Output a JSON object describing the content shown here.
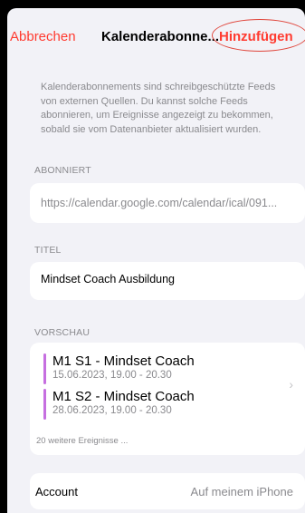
{
  "nav": {
    "cancel_label": "Abbrechen",
    "title": "Kalenderabonne...",
    "add_label": "Hinzufügen"
  },
  "intro_text": "Kalenderabonnements sind schreibgeschützte Feeds von externen Quellen. Du kannst solche Feeds abonnieren, um Ereignisse angezeigt zu bekommen, sobald sie vom Datenanbieter aktualisiert wurden.",
  "subscribed": {
    "header": "ABONNIERT",
    "url": "https://calendar.google.com/calendar/ical/091..."
  },
  "title_section": {
    "header": "TITEL",
    "value": "Mindset Coach Ausbildung"
  },
  "preview": {
    "header": "VORSCHAU",
    "events": [
      {
        "name": "M1 S1 - Mindset Coach",
        "time": "15.06.2023, 19.00 - 20.30"
      },
      {
        "name": "M1 S2 - Mindset Coach",
        "time": "28.06.2023, 19.00 - 20.30"
      }
    ],
    "more": "20 weitere Ereignisse ...",
    "chevron_icon": "chevron-right-icon"
  },
  "account": {
    "label": "Account",
    "value": "Auf meinem iPhone"
  },
  "colors": {
    "accent": "#ff3b30",
    "event_bar": "#c66fe0",
    "annotation_circle": "#e0463c"
  }
}
